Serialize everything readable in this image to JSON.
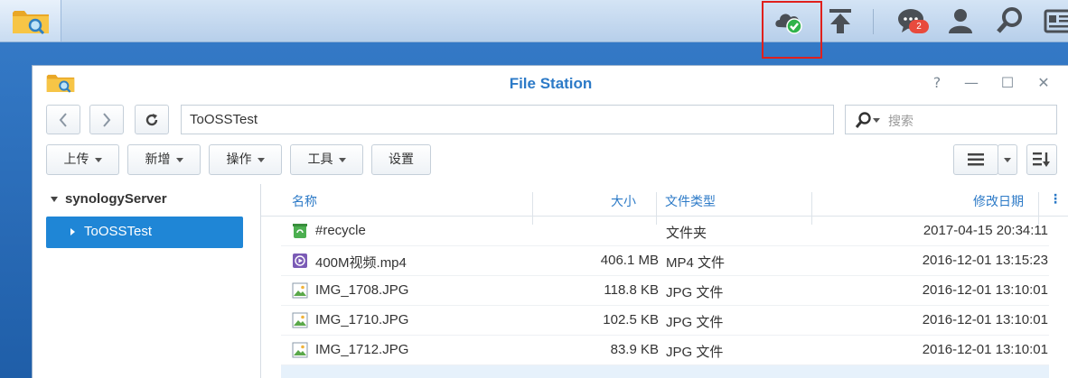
{
  "window": {
    "title": "File Station",
    "controls": {
      "help": "?",
      "minimize": "—",
      "maximize": "☐",
      "close": "✕"
    }
  },
  "taskbar": {
    "badge_count": "2"
  },
  "toolbar": {
    "path": "ToOSSTest",
    "search_placeholder": "搜索",
    "upload_label": "上传",
    "create_label": "新增",
    "action_label": "操作",
    "tools_label": "工具",
    "settings_label": "设置"
  },
  "tree": {
    "root": "synologyServer",
    "selected": "ToOSSTest"
  },
  "file_list": {
    "headers": {
      "name": "名称",
      "size": "大小",
      "type": "文件类型",
      "modified": "修改日期"
    },
    "rows": [
      {
        "icon": "recycle-folder-icon",
        "name": "#recycle",
        "size": "",
        "type": "文件夹",
        "modified": "2017-04-15 20:34:11"
      },
      {
        "icon": "video-file-icon",
        "name": "400M视频.mp4",
        "size": "406.1 MB",
        "type": "MP4 文件",
        "modified": "2016-12-01 13:15:23"
      },
      {
        "icon": "image-file-icon",
        "name": "IMG_1708.JPG",
        "size": "118.8 KB",
        "type": "JPG 文件",
        "modified": "2016-12-01 13:10:01"
      },
      {
        "icon": "image-file-icon",
        "name": "IMG_1710.JPG",
        "size": "102.5 KB",
        "type": "JPG 文件",
        "modified": "2016-12-01 13:10:01"
      },
      {
        "icon": "image-file-icon",
        "name": "IMG_1712.JPG",
        "size": "83.9 KB",
        "type": "JPG 文件",
        "modified": "2016-12-01 13:10:01"
      }
    ]
  },
  "colors": {
    "accent": "#2c7ac7",
    "selection": "#1f86d6",
    "highlight_box": "#e0201c",
    "status_ok": "#2fb34a",
    "badge": "#e84a3d"
  }
}
